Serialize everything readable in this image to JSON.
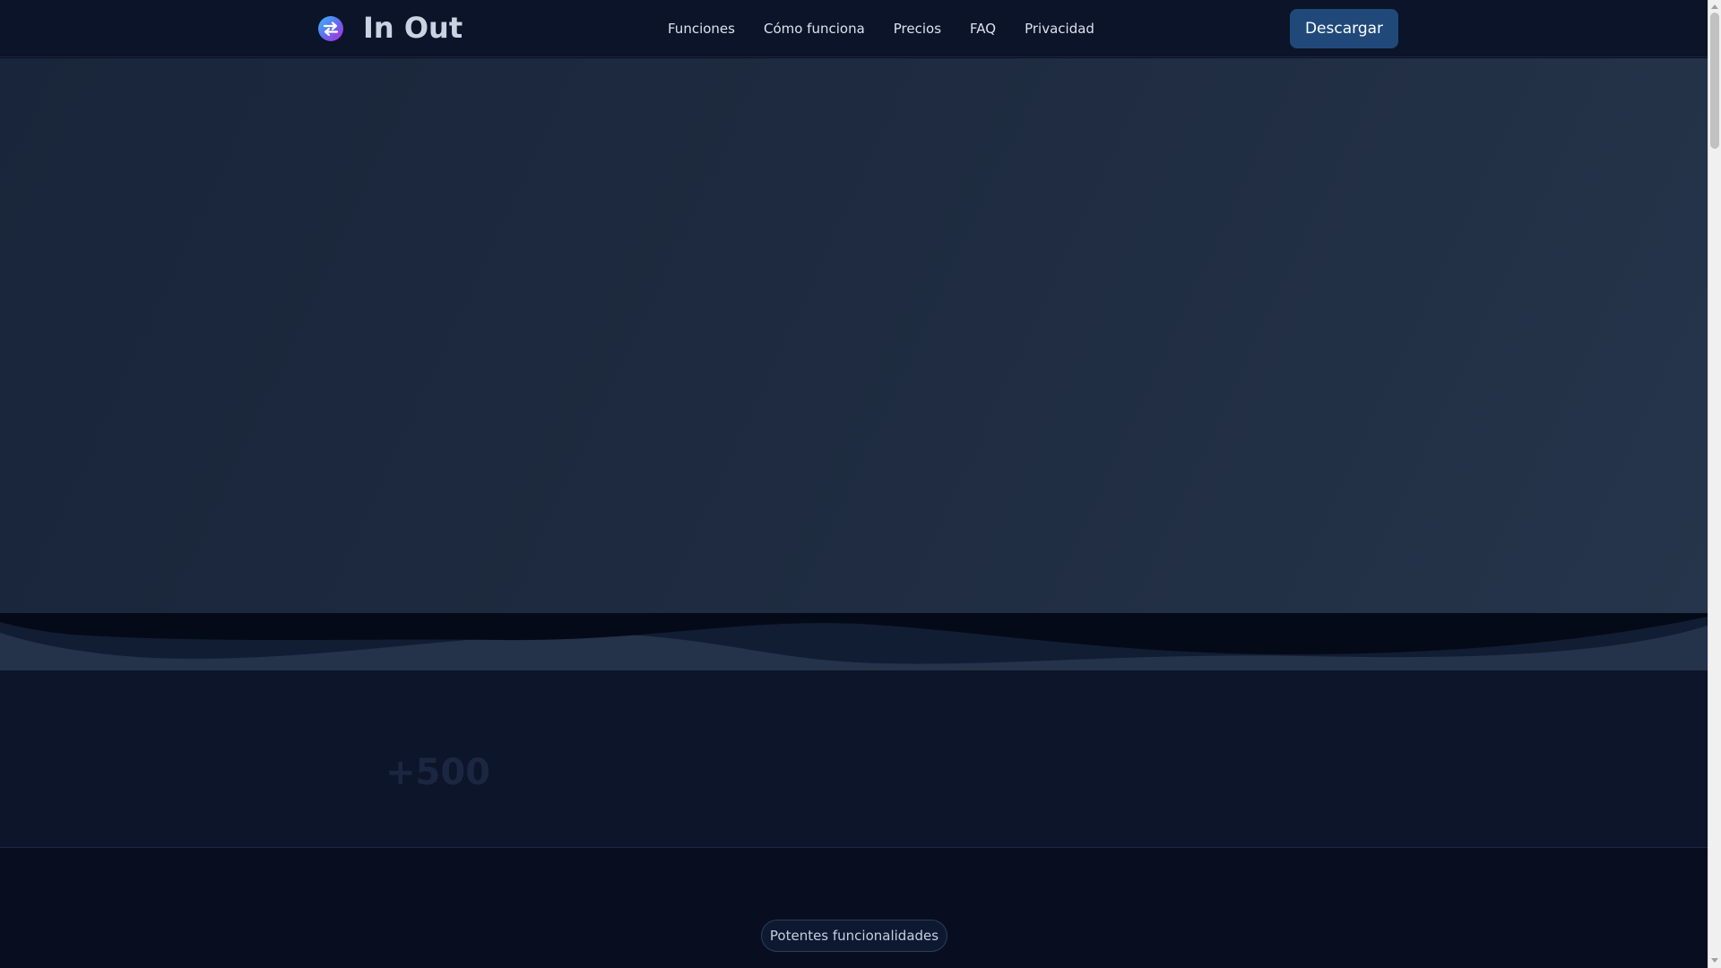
{
  "header": {
    "logo_icon": "swap-arrows-icon",
    "brand": "In Out",
    "nav": [
      {
        "label": "Funciones"
      },
      {
        "label": "Cómo funciona"
      },
      {
        "label": "Precios"
      },
      {
        "label": "FAQ"
      },
      {
        "label": "Privacidad"
      }
    ],
    "download_label": "Descargar"
  },
  "stats": {
    "value": "+500"
  },
  "features": {
    "badge": "Potentes funcionalidades"
  },
  "colors": {
    "header_bg": "#0b1428",
    "accent_button": "#20497a",
    "hero_start": "#19253a",
    "hero_end": "#26354b",
    "page_bg": "#080e1f"
  }
}
